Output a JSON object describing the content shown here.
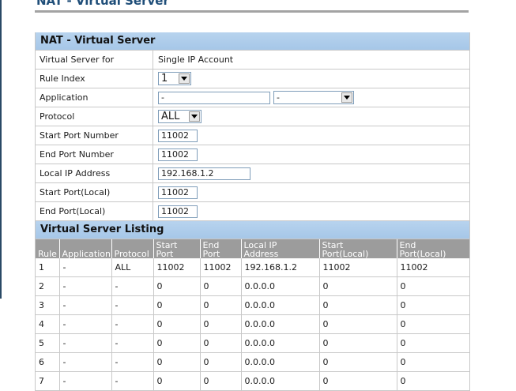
{
  "page": {
    "title": "NAT - Virtual Server"
  },
  "form": {
    "section_title": "NAT - Virtual Server",
    "rows": {
      "virtual_server_for": {
        "label": "Virtual Server for",
        "value": "Single IP Account"
      },
      "rule_index": {
        "label": "Rule Index",
        "value": "1"
      },
      "application": {
        "label": "Application",
        "text_value": "-",
        "select_value": "-"
      },
      "protocol": {
        "label": "Protocol",
        "value": "ALL"
      },
      "start_port_number": {
        "label": "Start Port Number",
        "value": "11002"
      },
      "end_port_number": {
        "label": "End Port Number",
        "value": "11002"
      },
      "local_ip_address": {
        "label": "Local IP Address",
        "value": "192.168.1.2"
      },
      "start_port_local": {
        "label": "Start Port(Local)",
        "value": "11002"
      },
      "end_port_local": {
        "label": "End Port(Local)",
        "value": "11002"
      }
    }
  },
  "listing": {
    "section_title": "Virtual Server Listing",
    "headers": {
      "rule": "Rule",
      "application": "Application",
      "protocol": "Protocol",
      "start_port_1": "Start",
      "start_port_2": "Port",
      "end_port_1": "End",
      "end_port_2": "Port",
      "local_ip_1": "Local IP",
      "local_ip_2": "Address",
      "start_local_1": "Start",
      "start_local_2": "Port(Local)",
      "end_local_1": "End",
      "end_local_2": "Port(Local)"
    },
    "rows": [
      {
        "rule": "1",
        "application": "-",
        "protocol": "ALL",
        "start_port": "11002",
        "end_port": "11002",
        "local_ip": "192.168.1.2",
        "start_local": "11002",
        "end_local": "11002"
      },
      {
        "rule": "2",
        "application": "-",
        "protocol": "-",
        "start_port": "0",
        "end_port": "0",
        "local_ip": "0.0.0.0",
        "start_local": "0",
        "end_local": "0"
      },
      {
        "rule": "3",
        "application": "-",
        "protocol": "-",
        "start_port": "0",
        "end_port": "0",
        "local_ip": "0.0.0.0",
        "start_local": "0",
        "end_local": "0"
      },
      {
        "rule": "4",
        "application": "-",
        "protocol": "-",
        "start_port": "0",
        "end_port": "0",
        "local_ip": "0.0.0.0",
        "start_local": "0",
        "end_local": "0"
      },
      {
        "rule": "5",
        "application": "-",
        "protocol": "-",
        "start_port": "0",
        "end_port": "0",
        "local_ip": "0.0.0.0",
        "start_local": "0",
        "end_local": "0"
      },
      {
        "rule": "6",
        "application": "-",
        "protocol": "-",
        "start_port": "0",
        "end_port": "0",
        "local_ip": "0.0.0.0",
        "start_local": "0",
        "end_local": "0"
      },
      {
        "rule": "7",
        "application": "-",
        "protocol": "-",
        "start_port": "0",
        "end_port": "0",
        "local_ip": "0.0.0.0",
        "start_local": "0",
        "end_local": "0"
      }
    ]
  },
  "icons": {
    "dropdown": "chevron-down-icon"
  }
}
